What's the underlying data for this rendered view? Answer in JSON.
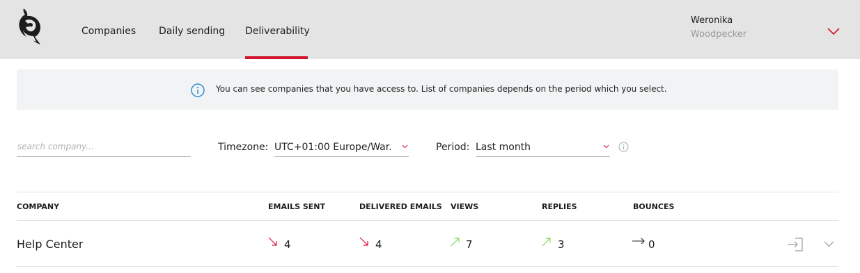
{
  "nav": {
    "items": [
      {
        "label": "Companies"
      },
      {
        "label": "Daily sending"
      },
      {
        "label": "Deliverability"
      }
    ],
    "active": "Deliverability"
  },
  "user": {
    "name": "Weronika",
    "company": "Woodpecker"
  },
  "info_banner": {
    "icon": "info-icon",
    "text": "You can see companies that you have access to. List of companies depends on the period which you select."
  },
  "filters": {
    "search": {
      "placeholder": "search company...",
      "value": ""
    },
    "timezone": {
      "label": "Timezone:",
      "value": "UTC+01:00 Europe/War..."
    },
    "period": {
      "label": "Period:",
      "value": "Last month"
    }
  },
  "table": {
    "columns": [
      "COMPANY",
      "EMAILS SENT",
      "DELIVERED EMAILS",
      "VIEWS",
      "REPLIES",
      "BOUNCES"
    ],
    "rows": [
      {
        "company": "Help Center",
        "emails_sent": {
          "value": "4",
          "trend": "down"
        },
        "delivered": {
          "value": "4",
          "trend": "down"
        },
        "views": {
          "value": "7",
          "trend": "up"
        },
        "replies": {
          "value": "3",
          "trend": "up"
        },
        "bounces": {
          "value": "0",
          "trend": "flat"
        }
      }
    ]
  },
  "colors": {
    "accent": "#d2132d",
    "trend_down": "#e0103a",
    "trend_up": "#7ed957",
    "trend_flat": "#222222",
    "header_bg": "#e4e4e4",
    "banner_bg": "#f2f3f4",
    "info_blue": "#2f8fd1"
  }
}
